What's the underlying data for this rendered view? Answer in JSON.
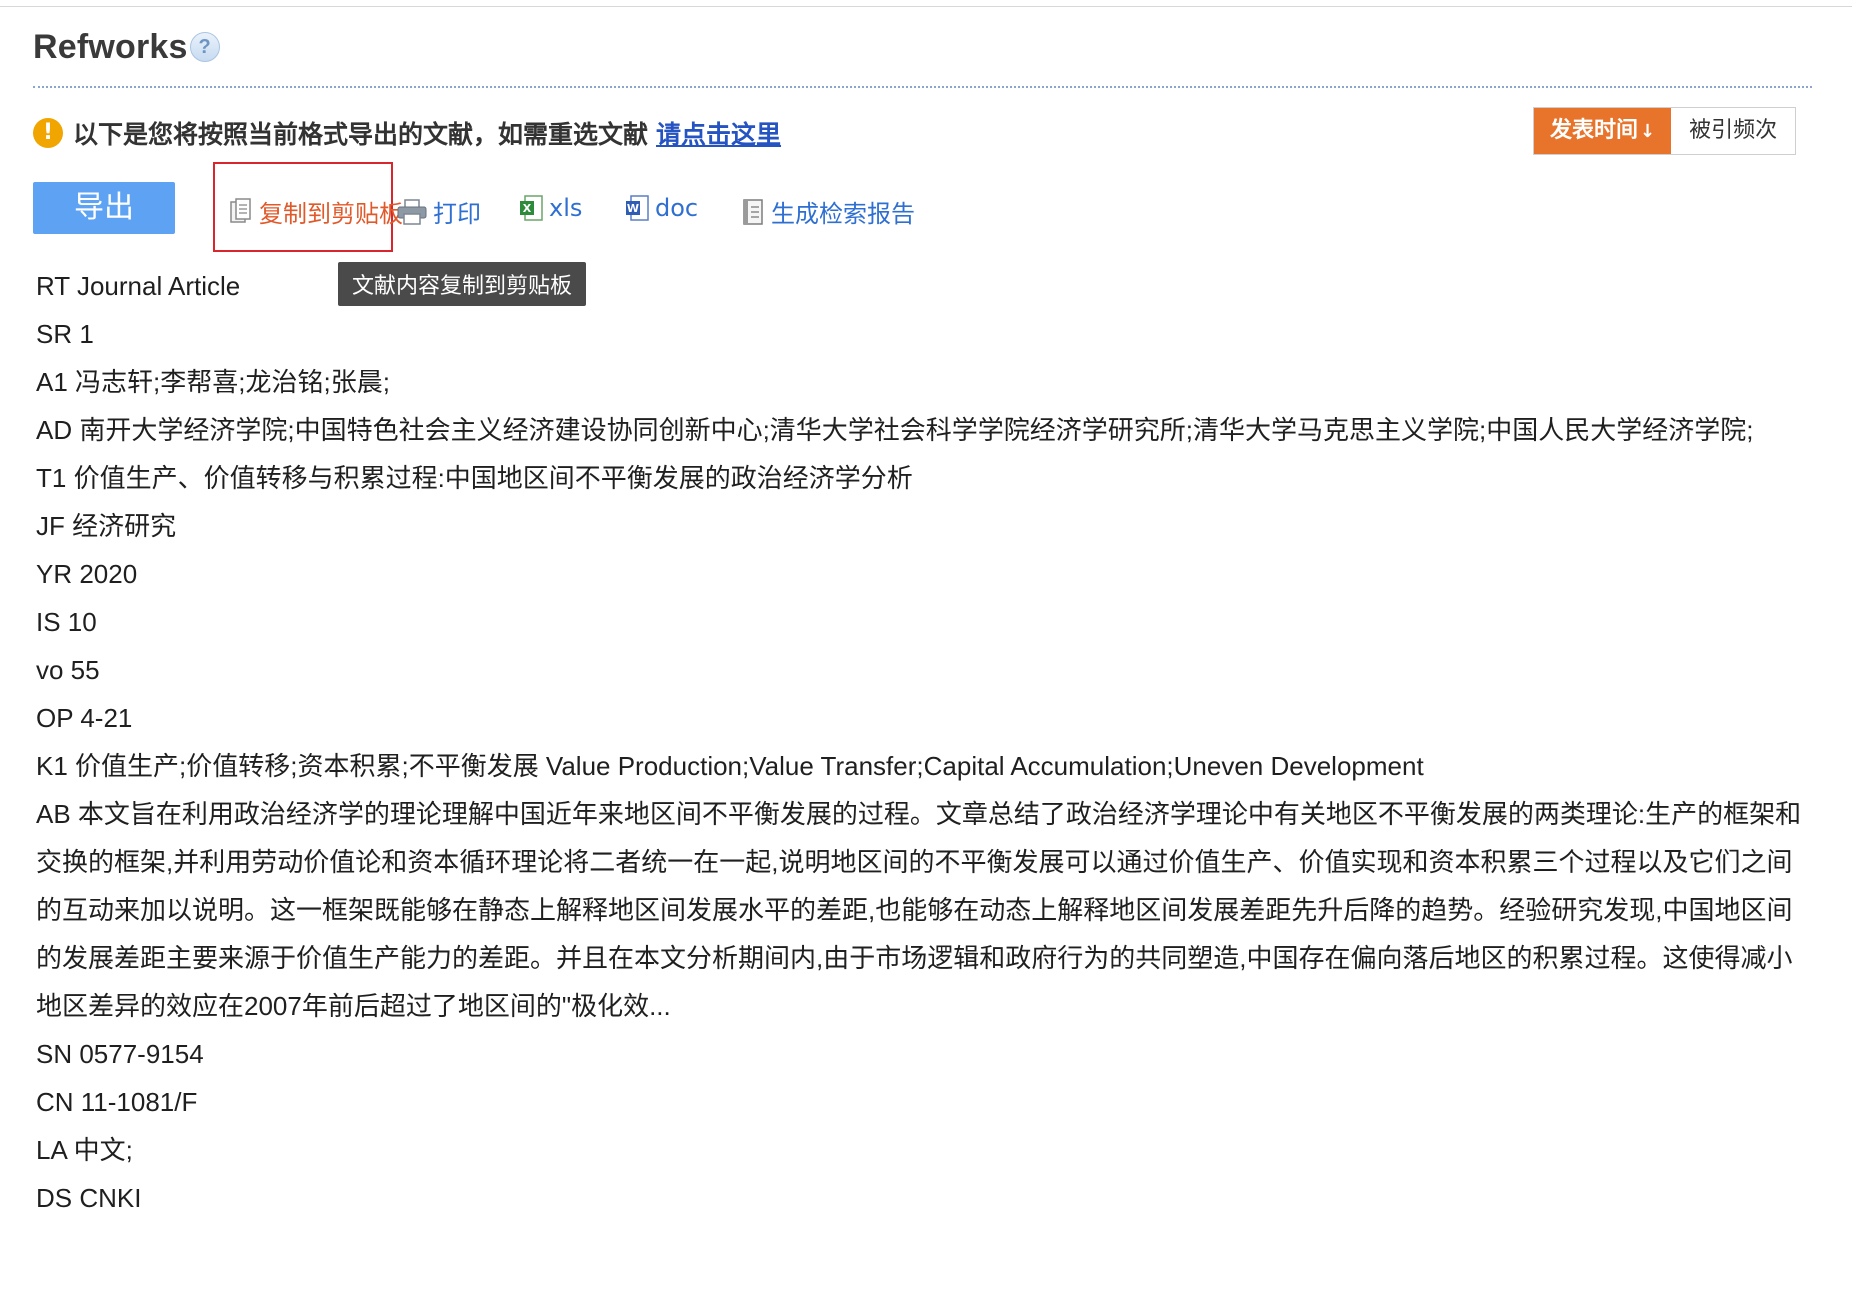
{
  "header": {
    "title": "Refworks",
    "help_icon": "?"
  },
  "notice": {
    "icon": "!",
    "text": "以下是您将按照当前格式导出的文献，如需重选文献",
    "link": "请点击这里"
  },
  "sort": {
    "publish_time": "发表时间",
    "publish_time_arrow": "↓",
    "citations": "被引频次"
  },
  "toolbar": {
    "export": "导出",
    "copy": "复制到剪贴板",
    "print": "打印",
    "xls": "xls",
    "doc": "doc",
    "report": "生成检索报告"
  },
  "tooltip": "文献内容复制到剪贴板",
  "record": [
    "RT Journal Article",
    "SR 1",
    "A1 冯志轩;李帮喜;龙治铭;张晨;",
    "AD 南开大学经济学院;中国特色社会主义经济建设协同创新中心;清华大学社会科学学院经济学研究所;清华大学马克思主义学院;中国人民大学经济学院;",
    "T1 价值生产、价值转移与积累过程:中国地区间不平衡发展的政治经济学分析",
    "JF 经济研究",
    "YR 2020",
    "IS 10",
    "vo 55",
    "OP 4-21",
    "K1 价值生产;价值转移;资本积累;不平衡发展 Value Production;Value Transfer;Capital Accumulation;Uneven Development",
    "AB 本文旨在利用政治经济学的理论理解中国近年来地区间不平衡发展的过程。文章总结了政治经济学理论中有关地区不平衡发展的两类理论:生产的框架和交换的框架,并利用劳动价值论和资本循环理论将二者统一在一起,说明地区间的不平衡发展可以通过价值生产、价值实现和资本积累三个过程以及它们之间的互动来加以说明。这一框架既能够在静态上解释地区间发展水平的差距,也能够在动态上解释地区间发展差距先升后降的趋势。经验研究发现,中国地区间的发展差距主要来源于价值生产能力的差距。并且在本文分析期间内,由于市场逻辑和政府行为的共同塑造,中国存在偏向落后地区的积累过程。这使得减小地区差异的效应在2007年前后超过了地区间的\"极化效...",
    "SN 0577-9154",
    "CN 11-1081/F",
    "LA 中文;",
    "DS CNKI"
  ]
}
